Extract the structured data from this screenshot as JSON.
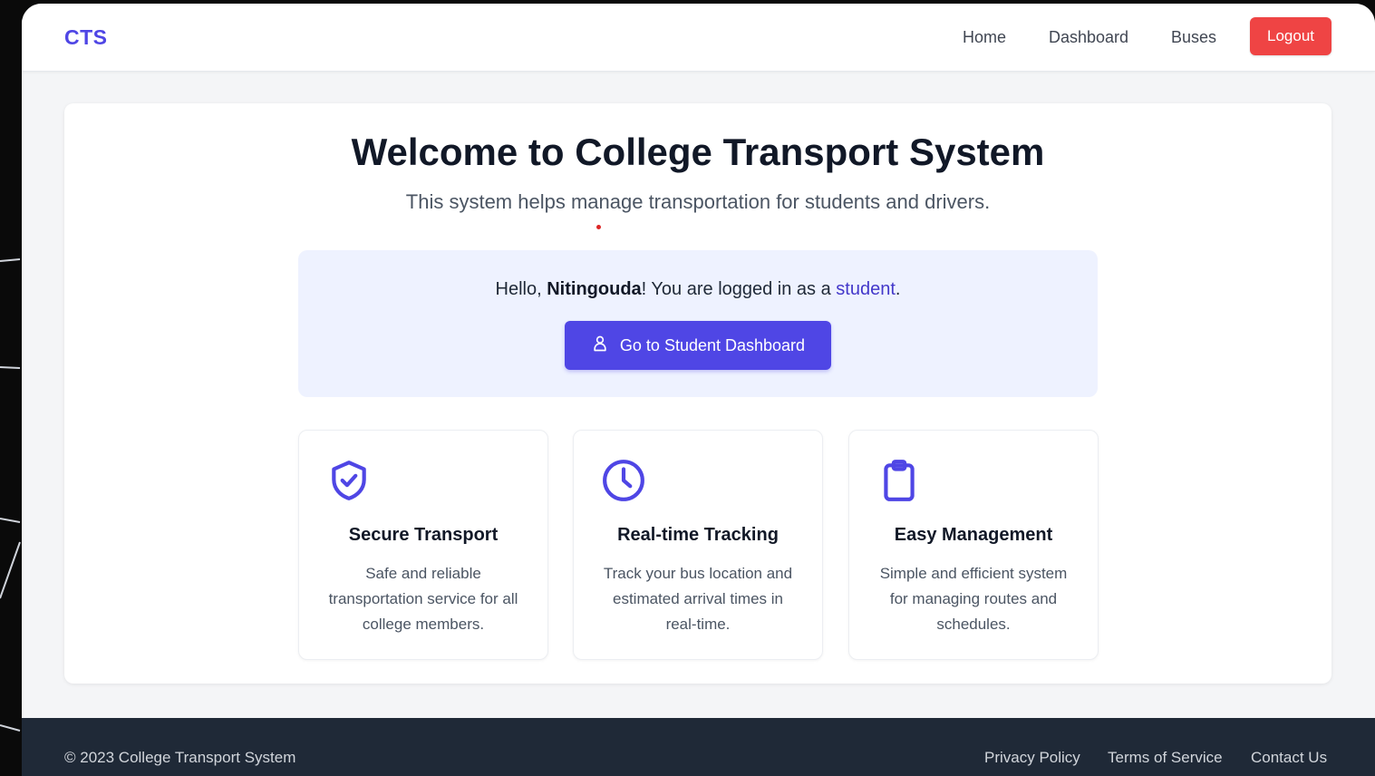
{
  "navbar": {
    "brand": "CTS",
    "links": [
      "Home",
      "Dashboard",
      "Buses"
    ],
    "logout_label": "Logout"
  },
  "hero": {
    "title": "Welcome to College Transport System",
    "subtitle": "This system helps manage transportation for students and drivers."
  },
  "greeting": {
    "prefix": "Hello, ",
    "user_name": "Nitingouda",
    "middle": "! You are logged in as a ",
    "role": "student",
    "suffix": ".",
    "button_label": "Go to Student Dashboard",
    "button_icon": "user-icon"
  },
  "features": [
    {
      "icon": "shield-check-icon",
      "title": "Secure Transport",
      "description": "Safe and reliable transportation service for all college members."
    },
    {
      "icon": "clock-icon",
      "title": "Real-time Tracking",
      "description": "Track your bus location and estimated arrival times in real-time."
    },
    {
      "icon": "clipboard-icon",
      "title": "Easy Management",
      "description": "Simple and efficient system for managing routes and schedules."
    }
  ],
  "footer": {
    "copyright": "© 2023 College Transport System",
    "links": [
      "Privacy Policy",
      "Terms of Service",
      "Contact Us"
    ]
  },
  "colors": {
    "primary": "#4f46e5",
    "logout": "#ef4444",
    "footer_bg": "#1f2937",
    "greeting_bg": "#eef2ff"
  }
}
